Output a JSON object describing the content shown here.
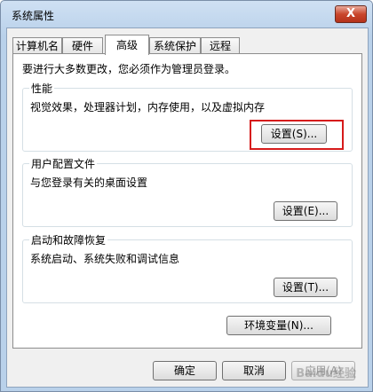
{
  "window": {
    "title": "系统属性",
    "close_label": "X"
  },
  "tabs": [
    {
      "label": "计算机名"
    },
    {
      "label": "硬件"
    },
    {
      "label": "高级"
    },
    {
      "label": "系统保护"
    },
    {
      "label": "远程"
    }
  ],
  "admin_note": "要进行大多数更改，您必须作为管理员登录。",
  "performance": {
    "title": "性能",
    "desc": "视觉效果，处理器计划，内存使用，以及虚拟内存",
    "button": "设置(S)..."
  },
  "user_profiles": {
    "title": "用户配置文件",
    "desc": "与您登录有关的桌面设置",
    "button": "设置(E)..."
  },
  "startup": {
    "title": "启动和故障恢复",
    "desc": "系统启动、系统失败和调试信息",
    "button": "设置(T)..."
  },
  "env_button": "环境变量(N)...",
  "footer": {
    "ok": "确定",
    "cancel": "取消",
    "apply": "应用(A)"
  },
  "watermark": "Baidu经验"
}
